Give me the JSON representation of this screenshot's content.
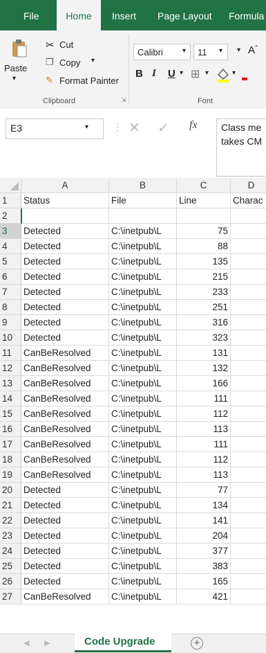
{
  "tabs": [
    "File",
    "Home",
    "Insert",
    "Page Layout",
    "Formula"
  ],
  "clipboard": {
    "paste": "Paste",
    "cut": "Cut",
    "copy": "Copy",
    "format_painter": "Format Painter",
    "group": "Clipboard"
  },
  "font": {
    "name": "Calibri",
    "size": "11",
    "group": "Font",
    "bold": "B",
    "italic": "I",
    "underline": "U"
  },
  "formula_bar": {
    "name_box": "E3",
    "fx": "fx",
    "content": "Class me\ntakes CM"
  },
  "columns": [
    "A",
    "B",
    "C",
    "D"
  ],
  "header_row": {
    "num": "1",
    "a": "Status",
    "b": "File",
    "c": "Line",
    "d": "Charac"
  },
  "rows": [
    {
      "n": "2",
      "a": "",
      "b": "",
      "c": ""
    },
    {
      "n": "3",
      "a": "Detected",
      "b": "C:\\inetpub\\L",
      "c": "75"
    },
    {
      "n": "4",
      "a": "Detected",
      "b": "C:\\inetpub\\L",
      "c": "88"
    },
    {
      "n": "5",
      "a": "Detected",
      "b": "C:\\inetpub\\L",
      "c": "135"
    },
    {
      "n": "6",
      "a": "Detected",
      "b": "C:\\inetpub\\L",
      "c": "215"
    },
    {
      "n": "7",
      "a": "Detected",
      "b": "C:\\inetpub\\L",
      "c": "233"
    },
    {
      "n": "8",
      "a": "Detected",
      "b": "C:\\inetpub\\L",
      "c": "251"
    },
    {
      "n": "9",
      "a": "Detected",
      "b": "C:\\inetpub\\L",
      "c": "316"
    },
    {
      "n": "10",
      "a": "Detected",
      "b": "C:\\inetpub\\L",
      "c": "323"
    },
    {
      "n": "11",
      "a": "CanBeResolved",
      "b": "C:\\inetpub\\L",
      "c": "131"
    },
    {
      "n": "12",
      "a": "CanBeResolved",
      "b": "C:\\inetpub\\L",
      "c": "132"
    },
    {
      "n": "13",
      "a": "CanBeResolved",
      "b": "C:\\inetpub\\L",
      "c": "166"
    },
    {
      "n": "14",
      "a": "CanBeResolved",
      "b": "C:\\inetpub\\L",
      "c": "111"
    },
    {
      "n": "15",
      "a": "CanBeResolved",
      "b": "C:\\inetpub\\L",
      "c": "112"
    },
    {
      "n": "16",
      "a": "CanBeResolved",
      "b": "C:\\inetpub\\L",
      "c": "113"
    },
    {
      "n": "17",
      "a": "CanBeResolved",
      "b": "C:\\inetpub\\L",
      "c": "111"
    },
    {
      "n": "18",
      "a": "CanBeResolved",
      "b": "C:\\inetpub\\L",
      "c": "112"
    },
    {
      "n": "19",
      "a": "CanBeResolved",
      "b": "C:\\inetpub\\L",
      "c": "113"
    },
    {
      "n": "20",
      "a": "Detected",
      "b": "C:\\inetpub\\L",
      "c": "77"
    },
    {
      "n": "21",
      "a": "Detected",
      "b": "C:\\inetpub\\L",
      "c": "134"
    },
    {
      "n": "22",
      "a": "Detected",
      "b": "C:\\inetpub\\L",
      "c": "141"
    },
    {
      "n": "23",
      "a": "Detected",
      "b": "C:\\inetpub\\L",
      "c": "204"
    },
    {
      "n": "24",
      "a": "Detected",
      "b": "C:\\inetpub\\L",
      "c": "377"
    },
    {
      "n": "25",
      "a": "Detected",
      "b": "C:\\inetpub\\L",
      "c": "383"
    },
    {
      "n": "26",
      "a": "Detected",
      "b": "C:\\inetpub\\L",
      "c": "165"
    },
    {
      "n": "27",
      "a": "CanBeResolved",
      "b": "C:\\inetpub\\L",
      "c": "421"
    }
  ],
  "sheet_tab": "Code Upgrade",
  "colors": {
    "excel_green": "#217346",
    "selected": "#217346"
  }
}
